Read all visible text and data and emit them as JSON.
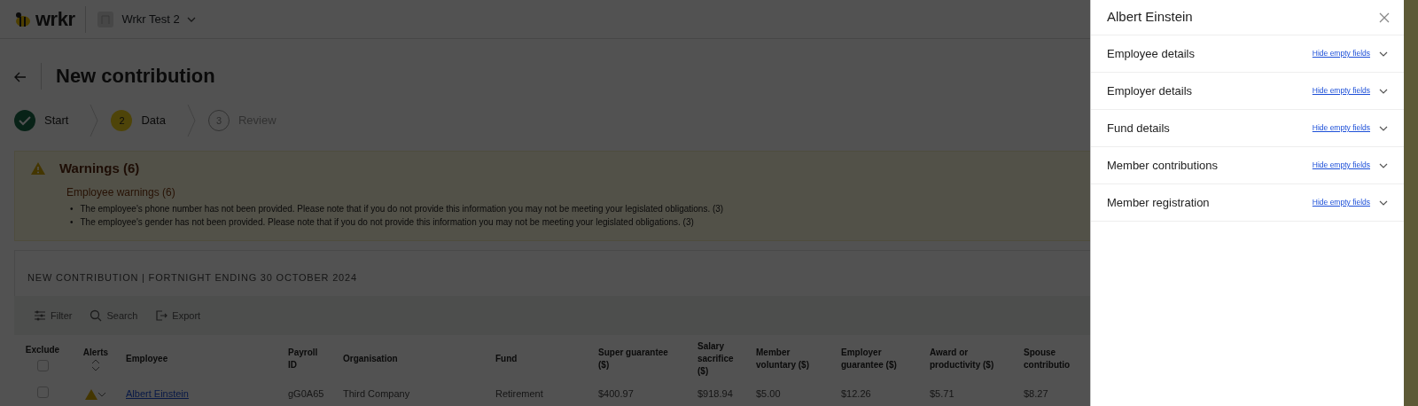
{
  "header": {
    "logo": "wrkr",
    "workspace": "Wrkr Test 2"
  },
  "page": {
    "title": "New contribution"
  },
  "steps": [
    {
      "label": "Start",
      "done": true,
      "selected": false
    },
    {
      "number": "2",
      "label": "Data",
      "done": false,
      "selected": true
    },
    {
      "number": "3",
      "label": "Review",
      "done": false,
      "selected": false
    }
  ],
  "warnings": {
    "title": "Warnings (6)",
    "group": "Employee warnings (6)",
    "items": [
      {
        "bullet": "•",
        "text": "The employee's phone number has not been provided. Please note that if you do not provide this information you may not be meeting your legislated obligations. (3)"
      },
      {
        "bullet": "•",
        "text": "The employee's gender has not been provided. Please note that if you do not provide this information you may not be meeting your legislated obligations. (3)"
      }
    ]
  },
  "section_title": "NEW CONTRIBUTION | FORTNIGHT ENDING 30 OCTOBER 2024",
  "toolbar": [
    {
      "label": "Filter",
      "kind": "filter"
    },
    {
      "label": "Search",
      "kind": "search"
    },
    {
      "label": "Export",
      "kind": "export"
    }
  ],
  "table": {
    "exclude_all_checked": false,
    "columns": [
      "Exclude",
      "Alerts",
      "Employee",
      "Payroll ID",
      "Organisation",
      "Fund",
      "Super guarantee ($)",
      "Salary sacrifice ($)",
      "Member voluntary ($)",
      "Employer guarantee ($)",
      "Award or productivity ($)",
      "Spouse contributio"
    ],
    "rows": [
      {
        "excluded": false,
        "alert": true,
        "employee": "Albert Einstein",
        "payroll_id": "gG0A65",
        "organisation": "Third Company",
        "fund": "Retirement",
        "values": [
          "$400.97",
          "$918.94",
          "$5.00",
          "$12.26",
          "$5.71",
          "$8.27"
        ]
      }
    ]
  },
  "panel": {
    "title": "Albert Einstein",
    "sections": [
      {
        "title": "Employee details",
        "link": "Hide empty fields",
        "expanded": false
      },
      {
        "title": "Employer details",
        "link": "Hide empty fields",
        "expanded": false
      },
      {
        "title": "Fund details",
        "link": "Hide empty fields",
        "expanded": false
      },
      {
        "title": "Member contributions",
        "link": "Hide empty fields",
        "expanded": false
      },
      {
        "title": "Member registration",
        "link": "Hide empty fields",
        "expanded": false
      }
    ]
  }
}
